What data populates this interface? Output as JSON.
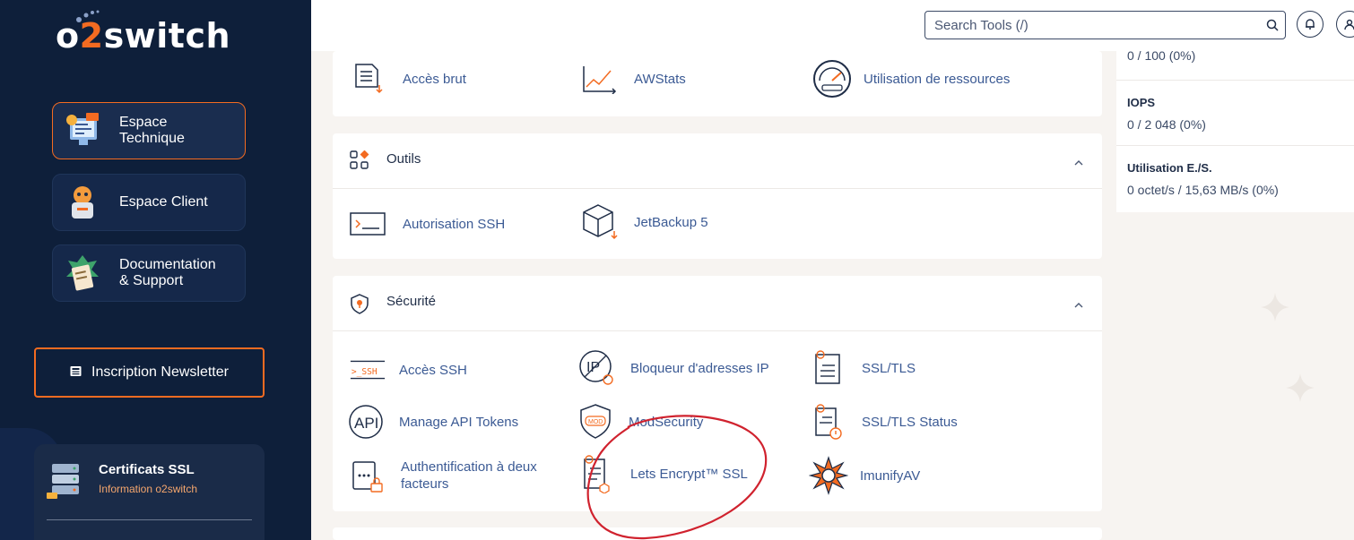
{
  "brand": {
    "logo_prefix": "o",
    "logo_digit": "2",
    "logo_suffix": "switch"
  },
  "sidebar": {
    "items": [
      {
        "label": "Espace\nTechnique",
        "icon": "monitor-code-icon",
        "active": true
      },
      {
        "label": "Espace Client",
        "icon": "robot-mascot-icon",
        "active": false
      },
      {
        "label": "Documentation\n& Support",
        "icon": "clipboard-docs-icon",
        "active": false
      }
    ],
    "newsletter": {
      "label": "Inscription Newsletter",
      "icon": "newspaper-icon"
    },
    "ssl_card": {
      "title": "Certificats SSL",
      "subtitle": "Information o2switch",
      "icon": "server-icon"
    }
  },
  "topbar": {
    "search_placeholder": "Search Tools (/)",
    "icons": [
      "search-icon",
      "bell-icon",
      "user-icon"
    ]
  },
  "sections": {
    "metrics_row": {
      "tools": [
        {
          "label": "Accès brut",
          "icon": "raw-access-icon"
        },
        {
          "label": "AWStats",
          "icon": "line-chart-icon"
        },
        {
          "label": "Utilisation de ressources",
          "icon": "gauge-icon"
        }
      ]
    },
    "outils": {
      "title": "Outils",
      "icon": "shapes-grid-icon",
      "tools": [
        {
          "label": "Autorisation SSH",
          "icon": "terminal-icon"
        },
        {
          "label": "JetBackup 5",
          "icon": "backup-box-icon"
        }
      ]
    },
    "securite": {
      "title": "Sécurité",
      "icon": "shield-icon",
      "tools": [
        {
          "label": "Accès SSH",
          "icon": "ssh-icon"
        },
        {
          "label": "Bloqueur d'adresses IP",
          "icon": "ip-blocker-icon"
        },
        {
          "label": "SSL/TLS",
          "icon": "certificate-icon"
        },
        {
          "label": "Manage API Tokens",
          "icon": "api-icon"
        },
        {
          "label": "ModSecurity",
          "icon": "mod-shield-icon"
        },
        {
          "label": "SSL/TLS Status",
          "icon": "certificate-status-icon"
        },
        {
          "label": "Authentification à deux\nfacteurs",
          "icon": "two-factor-icon"
        },
        {
          "label": "Lets Encrypt™ SSL",
          "icon": "letsencrypt-icon"
        },
        {
          "label": "ImunifyAV",
          "icon": "imunify-icon"
        }
      ]
    }
  },
  "stats": {
    "top_value": "0 / 100  (0%)",
    "iops": {
      "title": "IOPS",
      "value": "0 / 2 048  (0%)"
    },
    "io": {
      "title": "Utilisation E./S.",
      "value": "0 octet/s / 15,63 MB/s  (0%)"
    }
  },
  "colors": {
    "sidebar_bg": "#0e1f3a",
    "accent": "#f36b21",
    "link": "#3b5a94",
    "annotation": "#d0222e"
  }
}
